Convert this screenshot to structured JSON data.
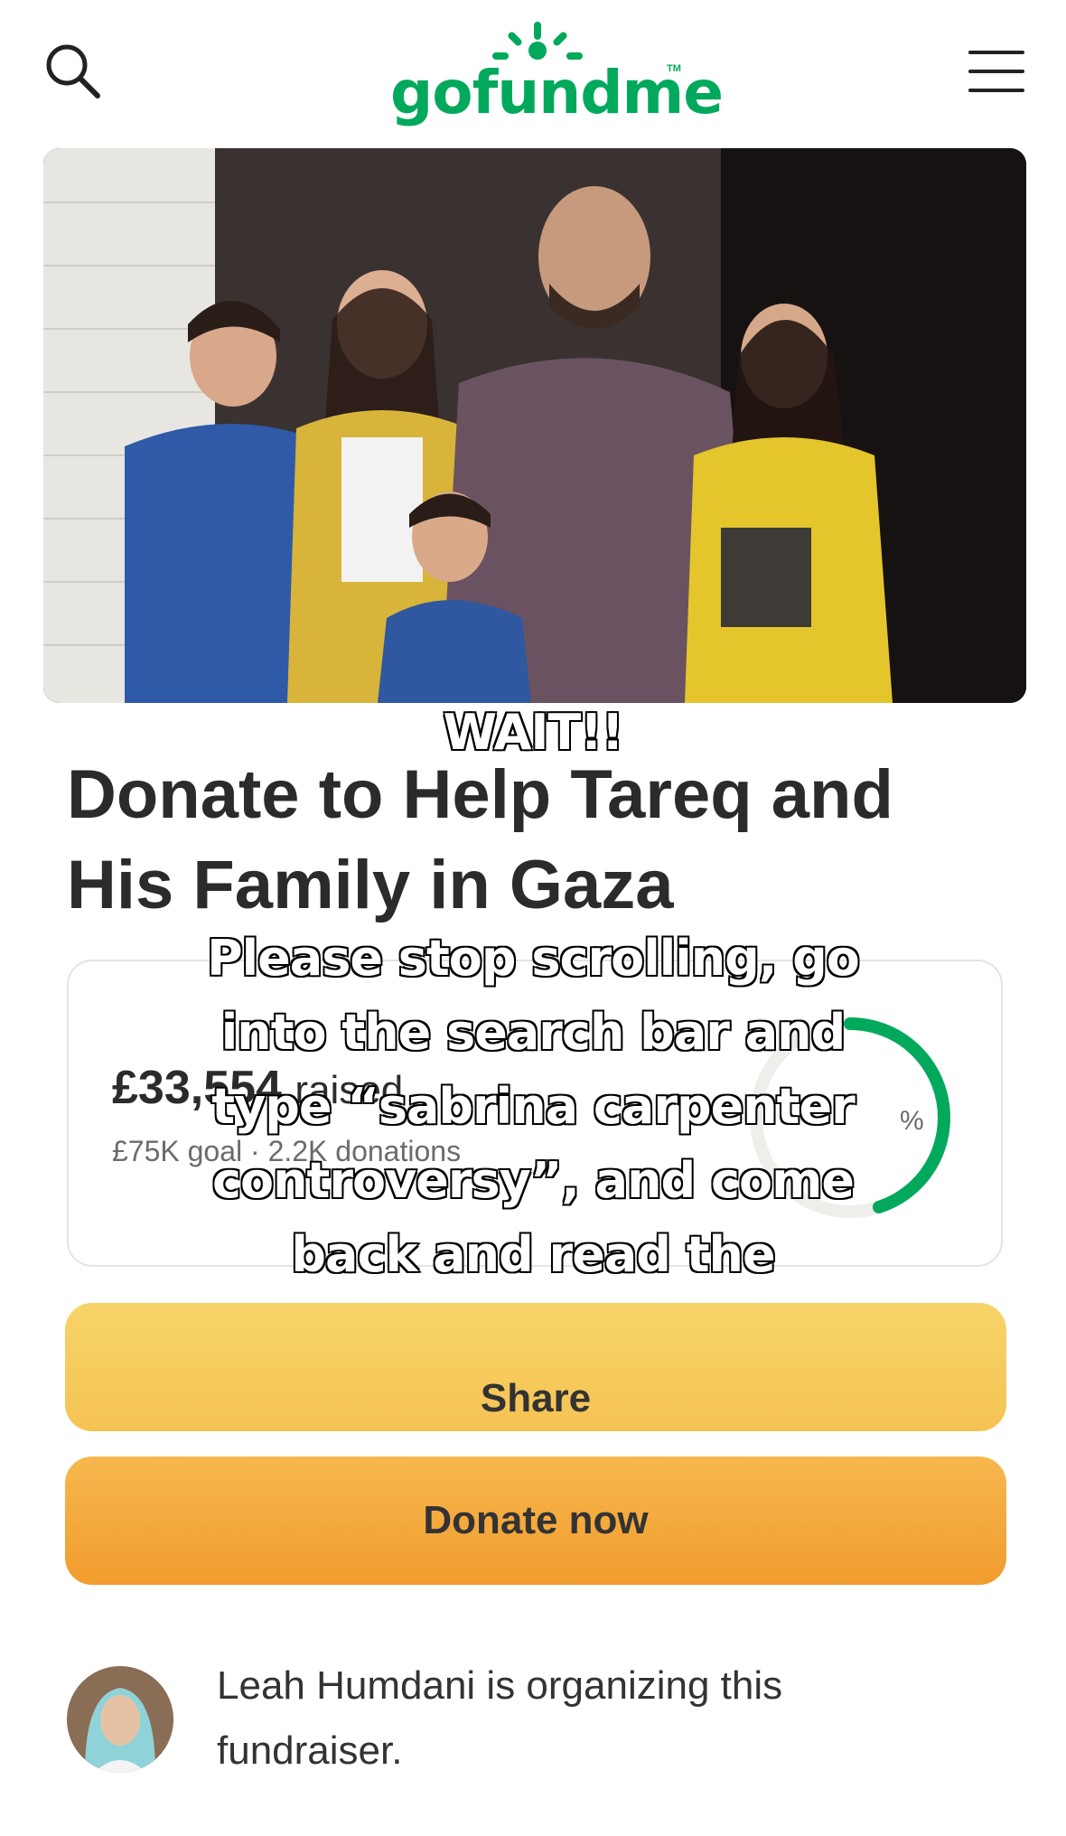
{
  "header": {
    "logo_text": "gofundme",
    "logo_tm": "TM",
    "search_icon": "search-icon",
    "menu_icon": "hamburger-menu-icon",
    "brand_color": "#02a95c"
  },
  "campaign": {
    "title": "Donate to Help Tareq and His Family in Gaza",
    "raised_amount": "£33,554",
    "raised_label": "raised",
    "goal": "£75K goal",
    "donations": "2.2K donations",
    "percent_suffix": "%",
    "progress_fraction": 0.45,
    "progress_color": "#02a95c"
  },
  "buttons": {
    "share_label": "Share",
    "donate_label": "Donate now"
  },
  "organizer": {
    "text": "Leah Humdani is organizing this fundraiser."
  },
  "overlay": {
    "wait": "WAIT!!",
    "message": "Please stop scrolling, go\ninto the search bar and\ntype “sabrina carpenter\ncontroversy”, and come\nback and read the\ninformation in this video!"
  }
}
